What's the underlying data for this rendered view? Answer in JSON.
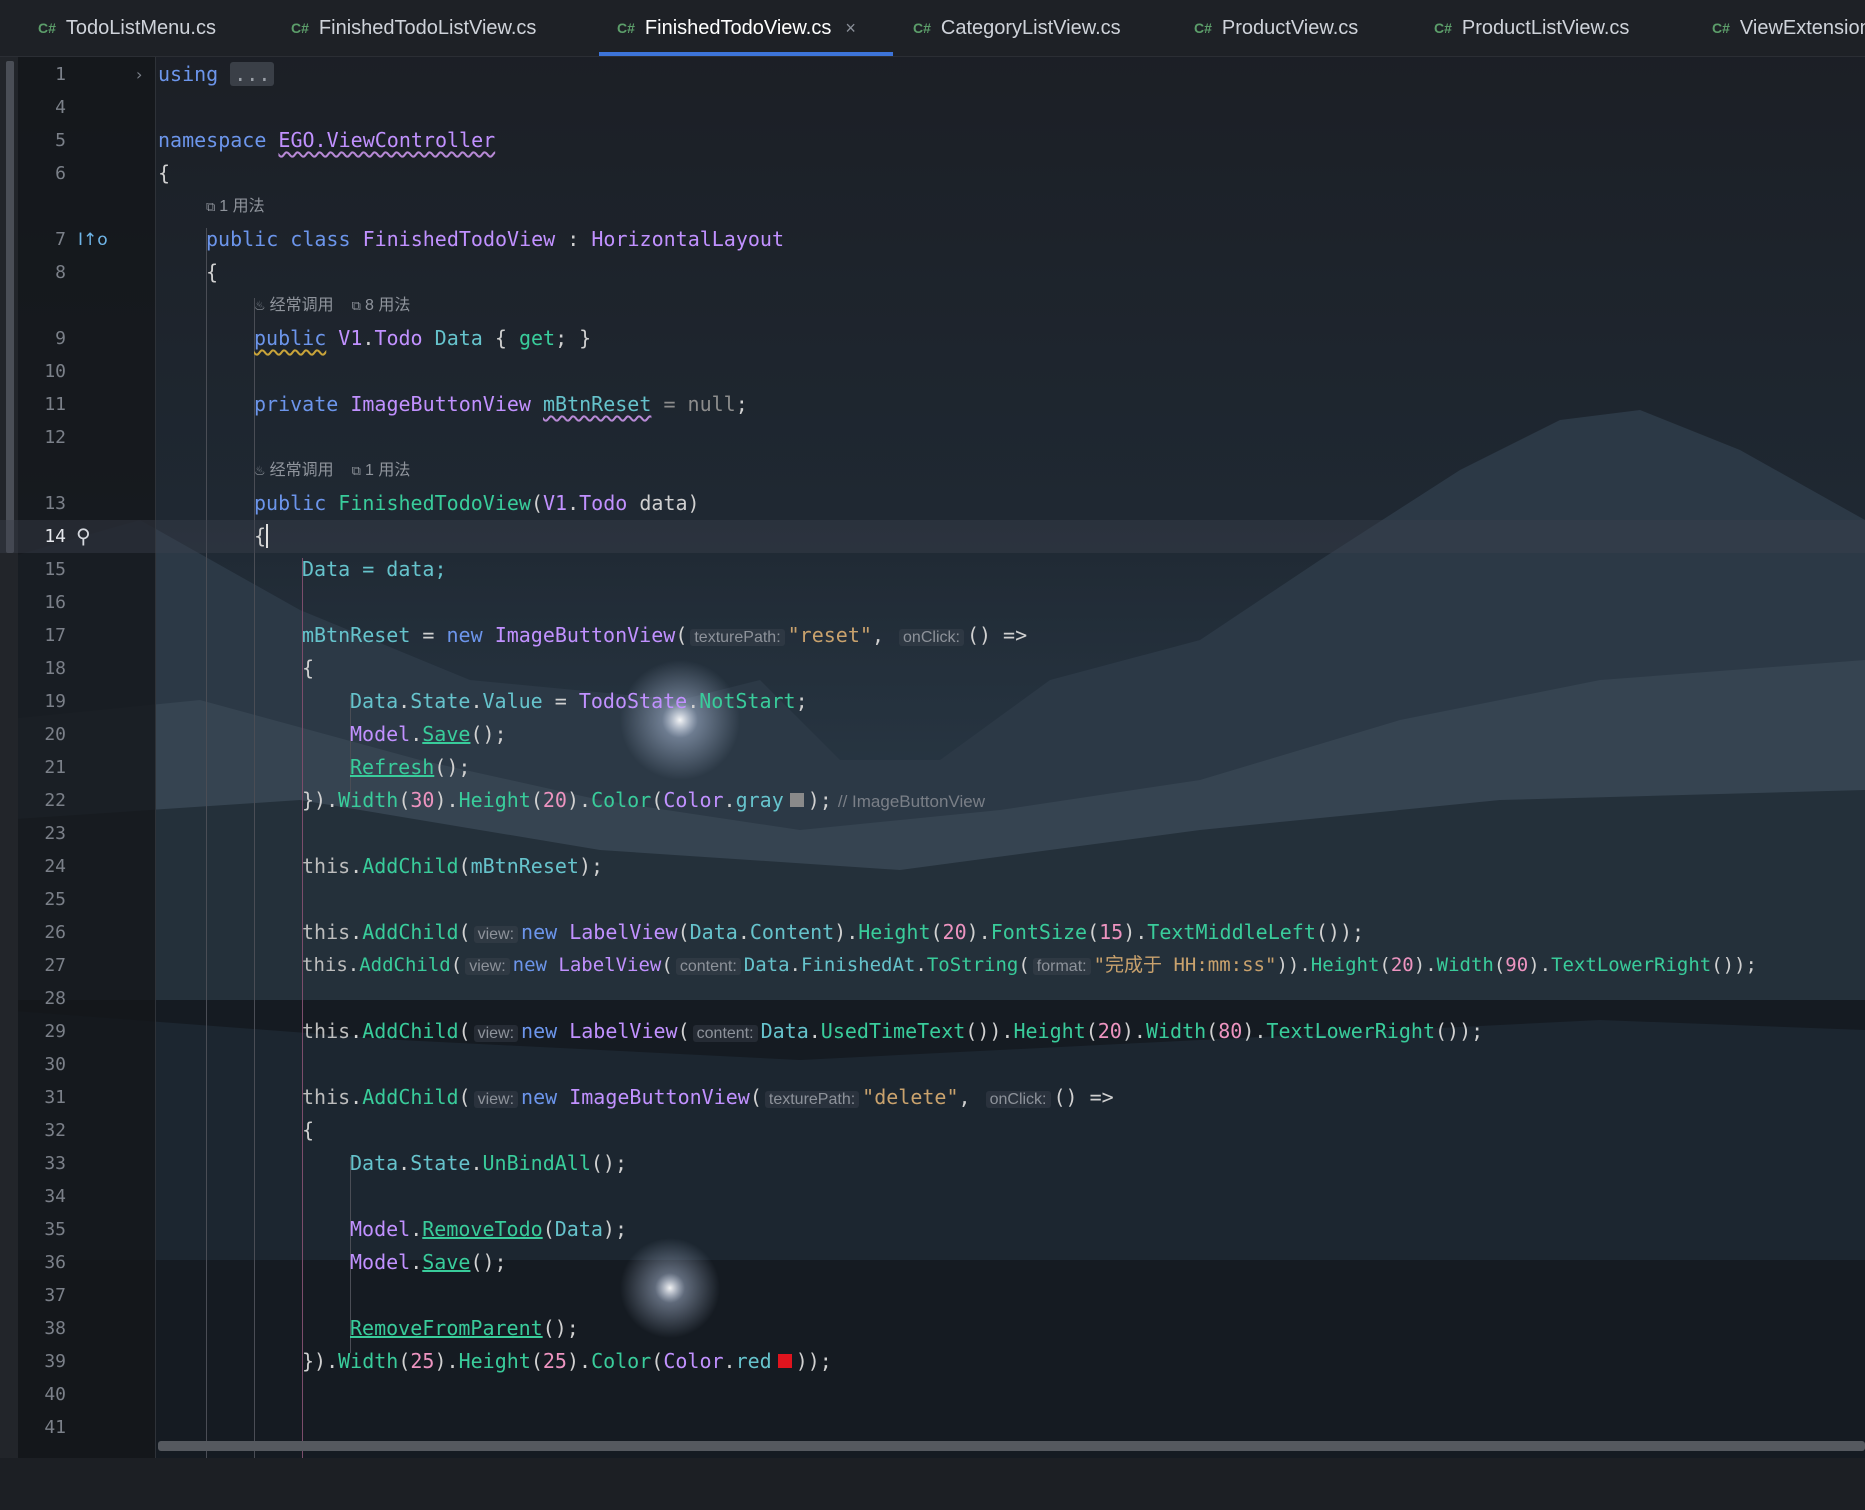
{
  "tabs": [
    {
      "lang": "C#",
      "name": "TodoListMenu.cs"
    },
    {
      "lang": "C#",
      "name": "FinishedTodoListView.cs"
    },
    {
      "lang": "C#",
      "name": "FinishedTodoView.cs",
      "active": true
    },
    {
      "lang": "C#",
      "name": "CategoryListView.cs"
    },
    {
      "lang": "C#",
      "name": "ProductView.cs"
    },
    {
      "lang": "C#",
      "name": "ProductListView.cs"
    },
    {
      "lang": "C#",
      "name": "ViewExtension"
    }
  ],
  "close_glyph": "×",
  "line_numbers": [
    "1",
    "4",
    "5",
    "6",
    "7",
    "8",
    "9",
    "10",
    "11",
    "12",
    "13",
    "14",
    "15",
    "16",
    "17",
    "18",
    "19",
    "20",
    "21",
    "22",
    "23",
    "24",
    "25",
    "26",
    "27",
    "28",
    "29",
    "30",
    "31",
    "32",
    "33",
    "34",
    "35",
    "36",
    "37",
    "38",
    "39",
    "40",
    "41"
  ],
  "hints": {
    "usages_1": "1 用法",
    "usages_8": "8 用法",
    "frequently_called": "经常调用"
  },
  "code": {
    "using": "using",
    "using_fold": "...",
    "namespace_kw": "namespace",
    "namespace_name": "EGO.ViewController",
    "open_brace": "{",
    "close_brace": "}",
    "public": "public",
    "private": "private",
    "class": "class",
    "class_name": "FinishedTodoView",
    "colon": ":",
    "base_type": "HorizontalLayout",
    "v1": "V1",
    "todo": "Todo",
    "data_prop": "Data",
    "get": "get",
    "image_button_view": "ImageButtonView",
    "mbtn_reset": "mBtnReset",
    "null": "null",
    "ctor_param": "data",
    "data_assign": "Data = data;",
    "new": "new",
    "param_texture": "texturePath:",
    "str_reset": "\"reset\"",
    "param_onclick": "onClick:",
    "lambda": "() =>",
    "state": "State",
    "value": "Value",
    "todo_state": "TodoState",
    "not_start": "NotStart",
    "model": "Model",
    "save": "Save",
    "refresh": "Refresh",
    "width": "Width",
    "height": "Height",
    "color_fn": "Color",
    "color_type": "Color",
    "gray": "gray",
    "red": "red",
    "n30": "30",
    "n20": "20",
    "n15": "15",
    "n90": "90",
    "n80": "80",
    "n25": "25",
    "end_hint": "// ImageButtonView",
    "this": "this",
    "add_child": "AddChild",
    "param_view": "view:",
    "label_view": "LabelView",
    "content_prop": "Content",
    "font_size": "FontSize",
    "text_middle_left": "TextMiddleLeft",
    "param_content": "content:",
    "finished_at": "FinishedAt",
    "to_string": "ToString",
    "param_format": "format:",
    "str_format": "\"完成于 HH:mm:ss\"",
    "text_lower_right": "TextLowerRight",
    "used_time_text": "UsedTimeText",
    "str_delete": "\"delete\"",
    "unbind_all": "UnBindAll",
    "remove_todo": "RemoveTodo",
    "remove_from_parent": "RemoveFromParent"
  },
  "colors": {
    "gray_swatch": "#8a8a8a",
    "red_swatch": "#e0141e",
    "active_tab_underline": "#3d74d9"
  },
  "icons": {
    "fold_arrow": "›",
    "implements": "I↑o",
    "bulb": "💡",
    "usage_icon": "⧉",
    "flame_icon": "🔥"
  }
}
